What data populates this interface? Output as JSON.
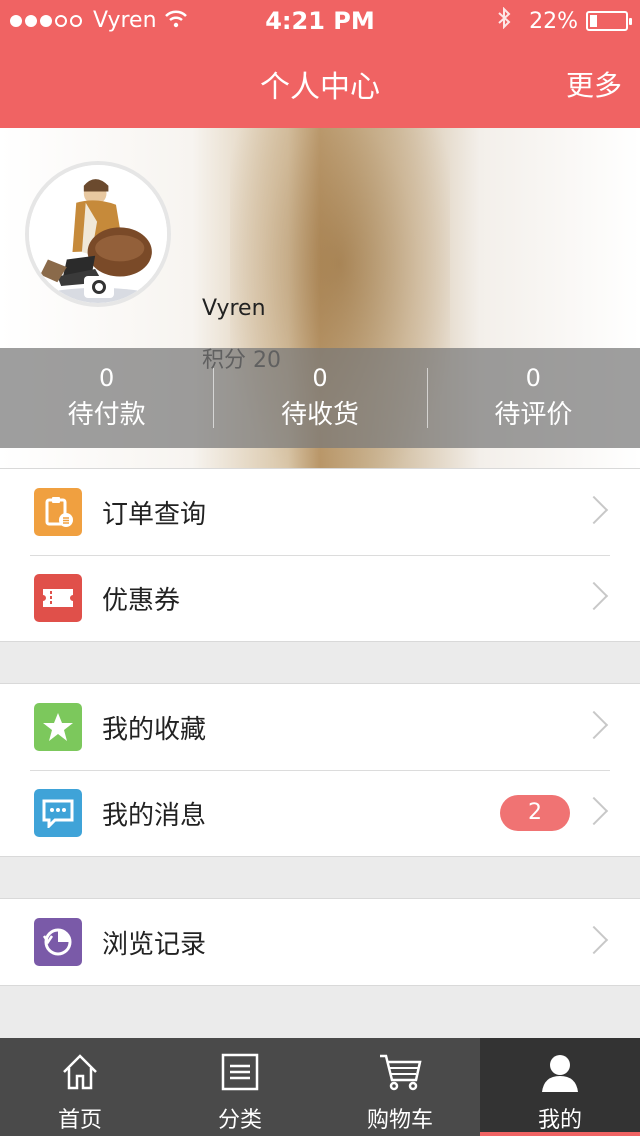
{
  "status_bar": {
    "carrier": "Vyren",
    "time": "4:21 PM",
    "battery": "22%",
    "battery_level": 0.22
  },
  "header": {
    "title": "个人中心",
    "more": "更多"
  },
  "profile": {
    "name": "Vyren",
    "points": "积分 20"
  },
  "stats": [
    {
      "count": "0",
      "label": "待付款"
    },
    {
      "count": "0",
      "label": "待收货"
    },
    {
      "count": "0",
      "label": "待评价"
    }
  ],
  "menu": {
    "group1": [
      {
        "label": "订单查询",
        "icon": "clipboard-icon",
        "color": "#f0a040"
      },
      {
        "label": "优惠券",
        "icon": "ticket-icon",
        "color": "#e0504a"
      }
    ],
    "group2": [
      {
        "label": "我的收藏",
        "icon": "star-icon",
        "color": "#7cc85c"
      },
      {
        "label": "我的消息",
        "icon": "message-icon",
        "color": "#3fa3d8",
        "badge": "2"
      }
    ],
    "group3": [
      {
        "label": "浏览记录",
        "icon": "history-icon",
        "color": "#7a5aa8"
      }
    ]
  },
  "tabbar": [
    {
      "label": "首页",
      "icon": "home-icon"
    },
    {
      "label": "分类",
      "icon": "list-icon"
    },
    {
      "label": "购物车",
      "icon": "cart-icon"
    },
    {
      "label": "我的",
      "icon": "user-icon",
      "active": true
    }
  ],
  "colors": {
    "accent": "#f06363",
    "tabbar": "#4a4a4a"
  }
}
